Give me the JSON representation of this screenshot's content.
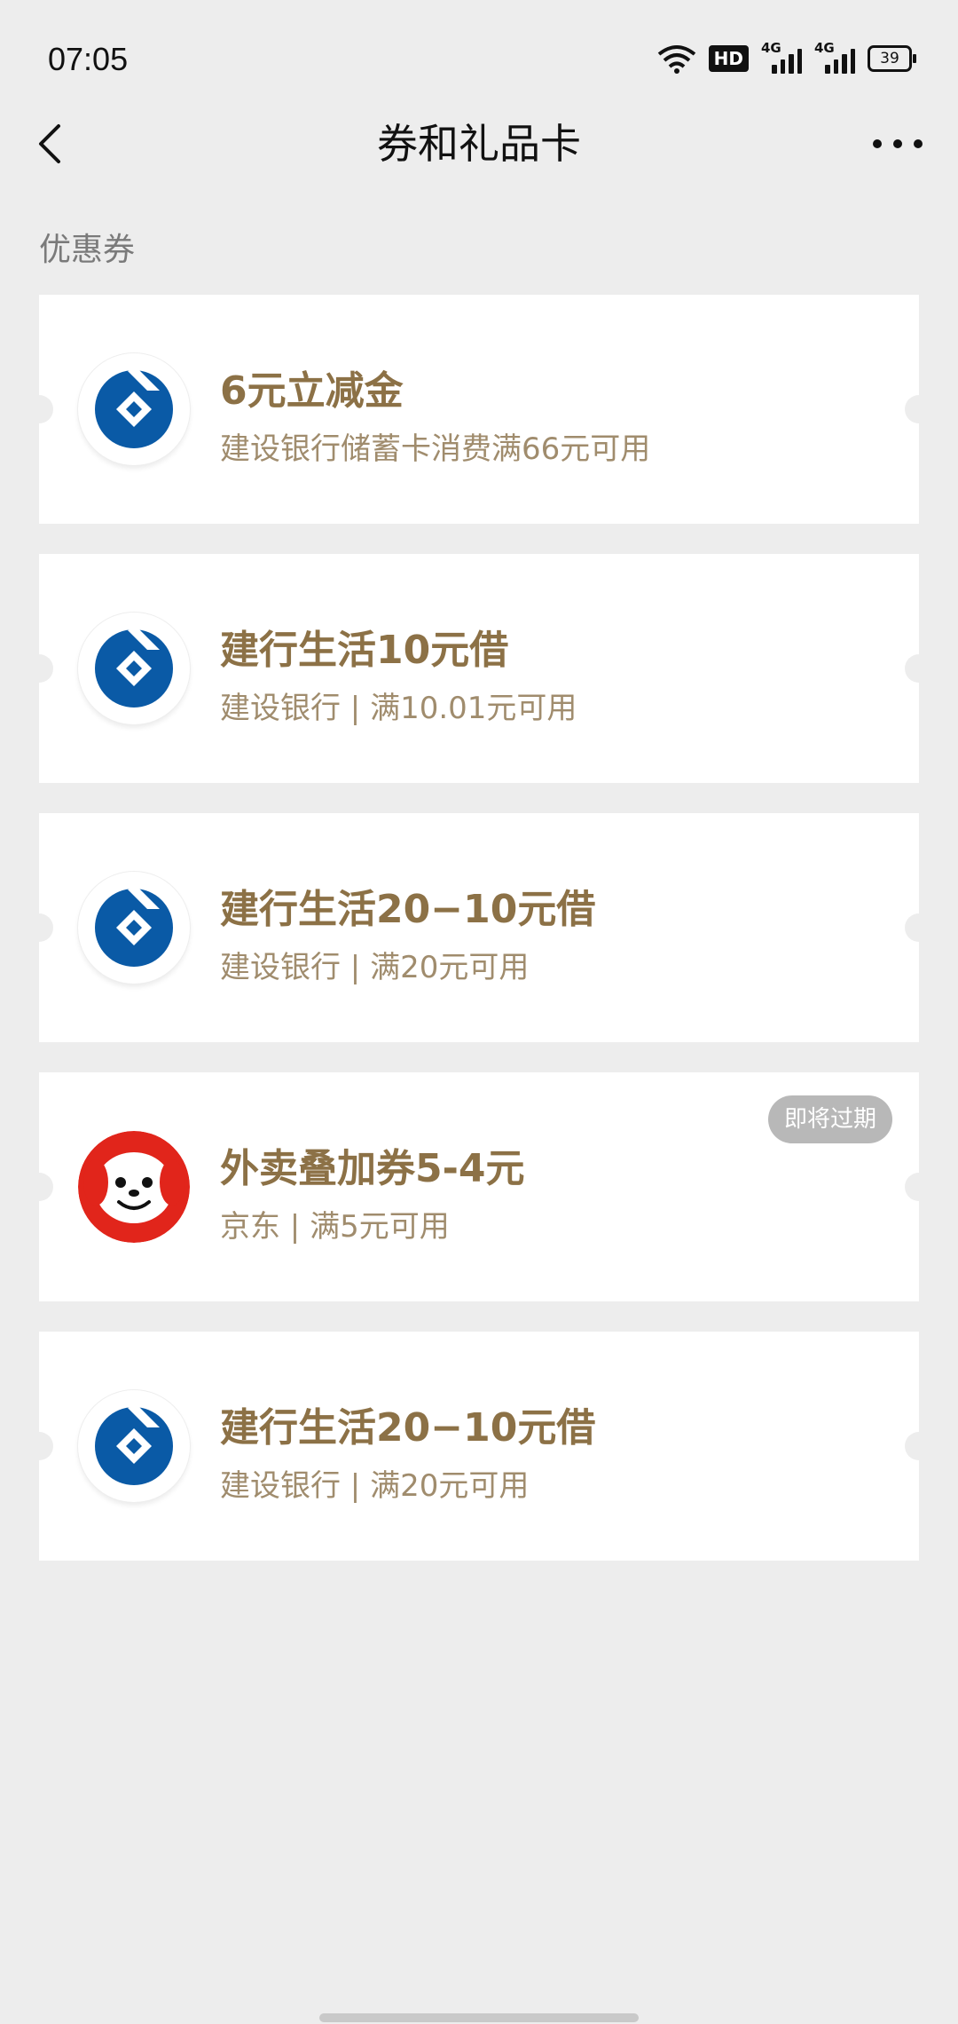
{
  "status": {
    "time": "07:05",
    "hd": "HD",
    "net1": "4G",
    "net2": "4G",
    "battery": "39"
  },
  "nav": {
    "title": "券和礼品卡"
  },
  "section": {
    "title": "优惠券"
  },
  "coupons": [
    {
      "name": "6元立减金",
      "desc": "建设银行储蓄卡消费满66元可用",
      "logo": "ccb-logo"
    },
    {
      "name": "建行生活10元借",
      "desc": "建设银行 | 满10.01元可用",
      "logo": "ccb-logo"
    },
    {
      "name": "建行生活20−10元借",
      "desc": "建设银行 | 满20元可用",
      "logo": "ccb-logo"
    },
    {
      "name": "外卖叠加券5-4元",
      "desc": "京东 | 满5元可用",
      "logo": "jd-logo",
      "badge": "即将过期"
    },
    {
      "name": "建行生活20−10元借",
      "desc": "建设银行 | 满20元可用",
      "logo": "ccb-logo"
    }
  ],
  "colors": {
    "accent": "#8c7146",
    "ccb_blue": "#0a5aa6",
    "jd_red": "#e1251b"
  }
}
